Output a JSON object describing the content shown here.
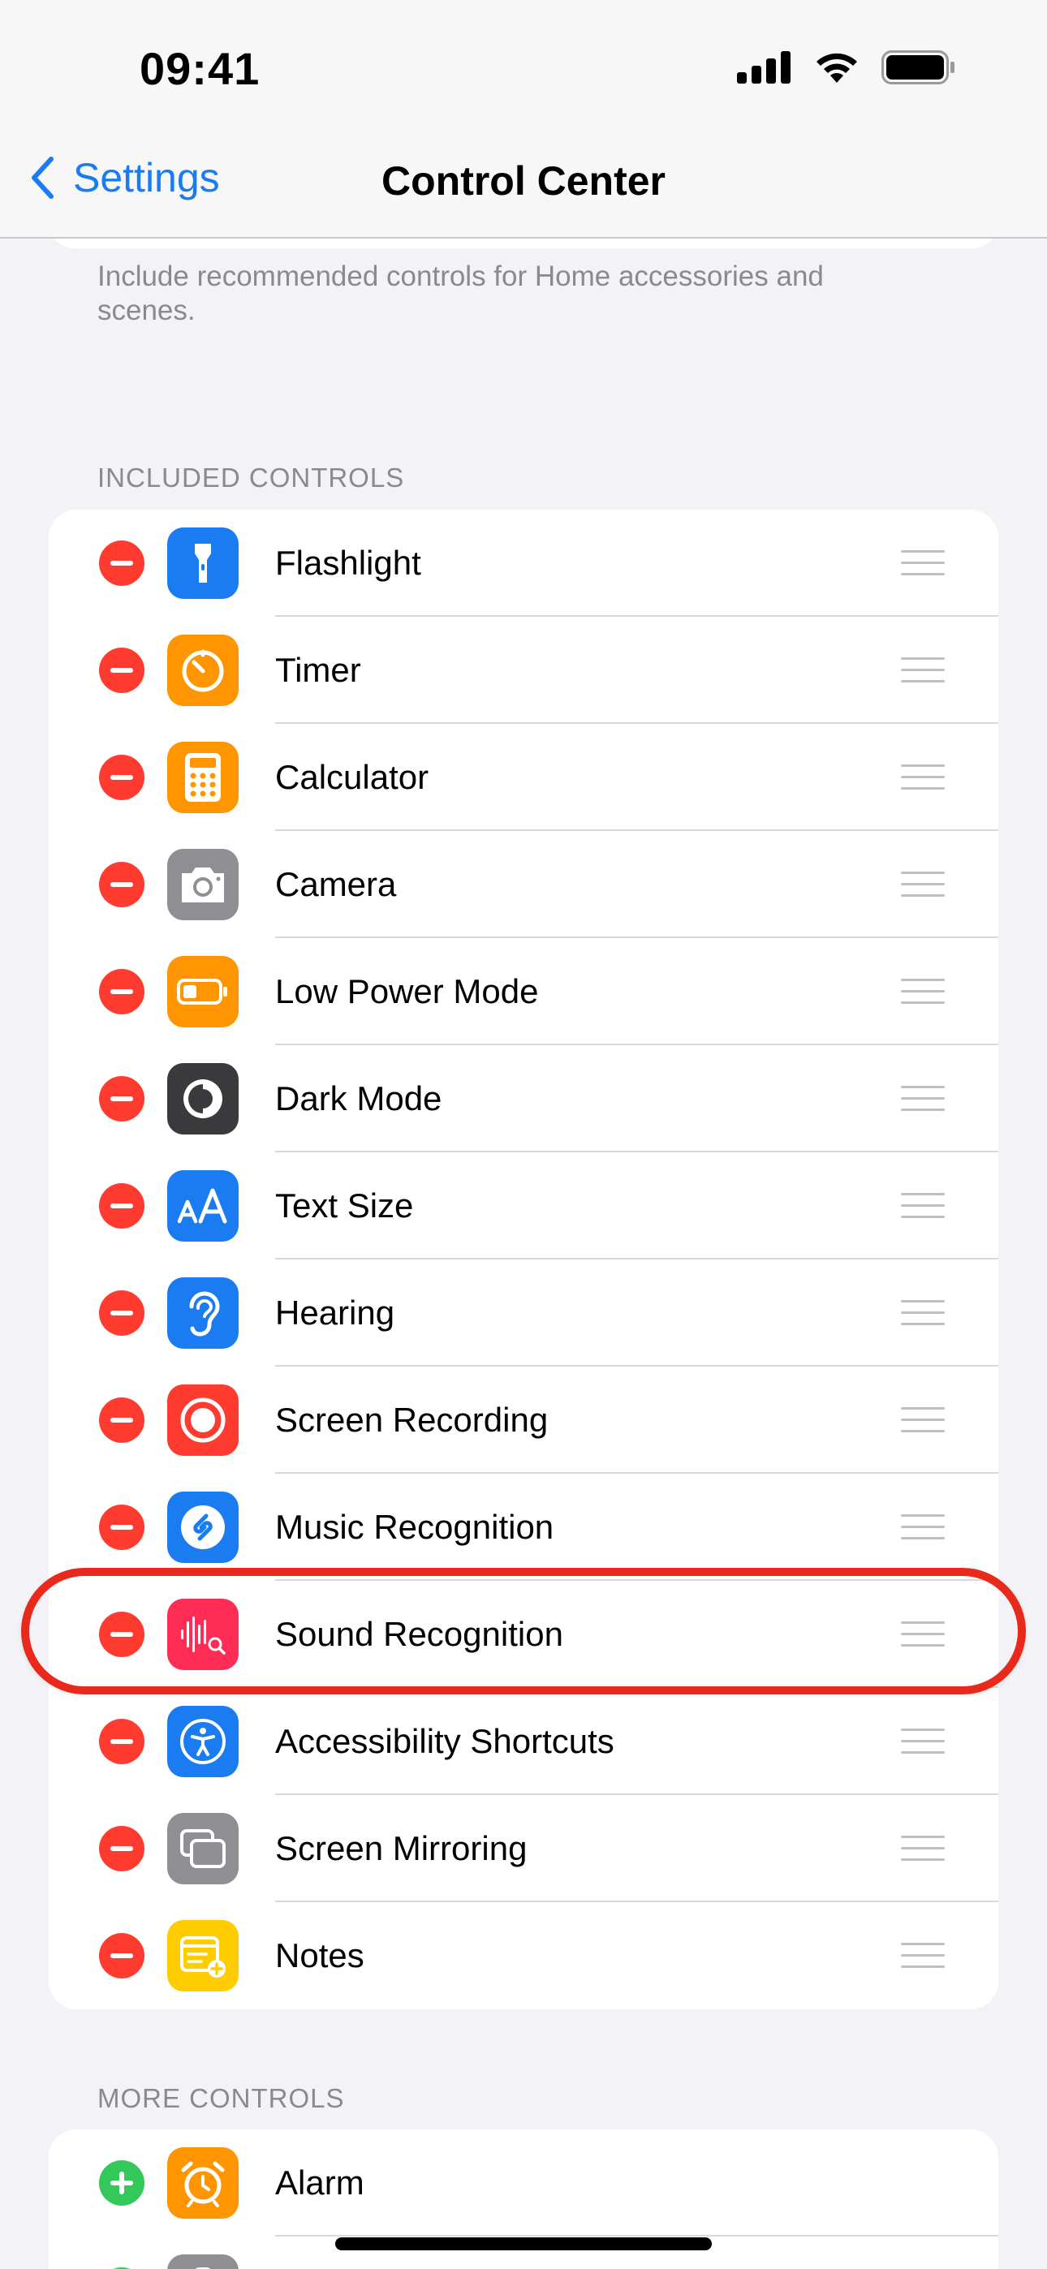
{
  "status_bar": {
    "time": "09:41"
  },
  "nav": {
    "back_label": "Settings",
    "title": "Control Center"
  },
  "top_footer": "Include recommended controls for Home accessories and scenes.",
  "included": {
    "header": "INCLUDED CONTROLS",
    "items": [
      {
        "label": "Flashlight",
        "icon": "flashlight-icon",
        "color": "#1a7cf0"
      },
      {
        "label": "Timer",
        "icon": "timer-icon",
        "color": "#ff9500"
      },
      {
        "label": "Calculator",
        "icon": "calculator-icon",
        "color": "#ff9500"
      },
      {
        "label": "Camera",
        "icon": "camera-icon",
        "color": "#8e8e93"
      },
      {
        "label": "Low Power Mode",
        "icon": "battery-icon",
        "color": "#ff9500"
      },
      {
        "label": "Dark Mode",
        "icon": "dark-mode-icon",
        "color": "#3a3a3c"
      },
      {
        "label": "Text Size",
        "icon": "text-size-icon",
        "color": "#1a7cf0"
      },
      {
        "label": "Hearing",
        "icon": "ear-icon",
        "color": "#1a7cf0"
      },
      {
        "label": "Screen Recording",
        "icon": "record-icon",
        "color": "#ff3b30"
      },
      {
        "label": "Music Recognition",
        "icon": "shazam-icon",
        "color": "#1a7cf0"
      },
      {
        "label": "Sound Recognition",
        "icon": "sound-recognition-icon",
        "color": "#ff2d55"
      },
      {
        "label": "Accessibility Shortcuts",
        "icon": "accessibility-icon",
        "color": "#1a7cf0"
      },
      {
        "label": "Screen Mirroring",
        "icon": "screen-mirroring-icon",
        "color": "#8e8e93"
      },
      {
        "label": "Notes",
        "icon": "notes-icon",
        "color": "#ffcc00"
      }
    ]
  },
  "more": {
    "header": "MORE CONTROLS",
    "items": [
      {
        "label": "Alarm",
        "icon": "alarm-icon",
        "color": "#ff9500"
      },
      {
        "label": "",
        "icon": "remote-icon",
        "color": "#8e8e93"
      }
    ]
  },
  "colors": {
    "accent": "#1a7cf0",
    "remove": "#ff3b30",
    "add": "#34c759",
    "highlight": "#e8291c"
  }
}
